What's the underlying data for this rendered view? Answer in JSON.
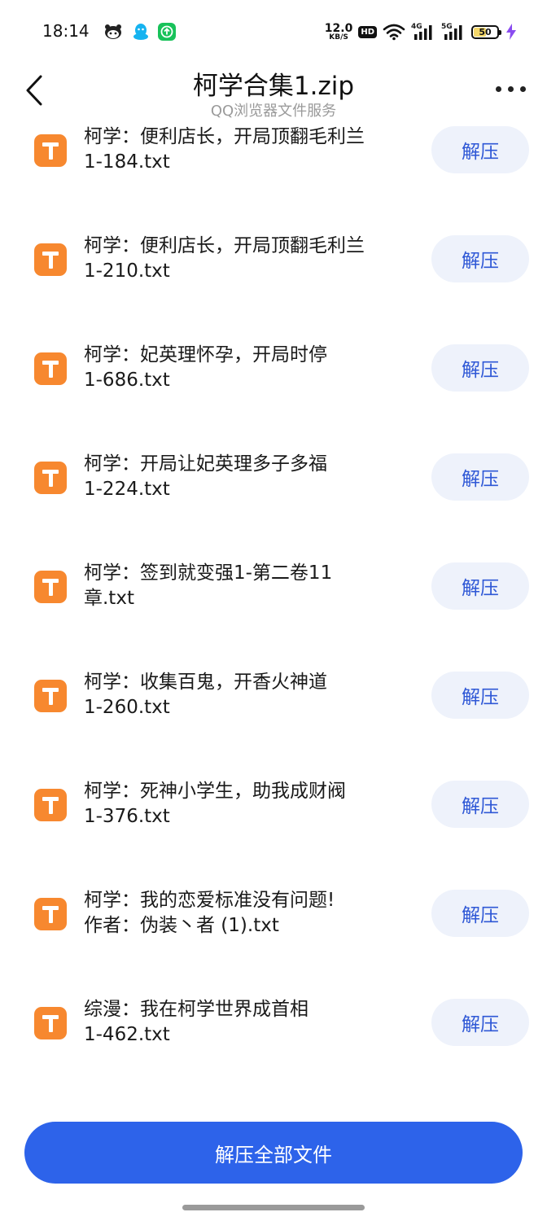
{
  "status_bar": {
    "time": "18:14",
    "net_speed_value": "12.0",
    "net_speed_unit": "KB/S",
    "hd_badge": "HD",
    "signal1_tag": "4G",
    "signal2_tag": "5G",
    "battery_level": 50,
    "battery_text": "50"
  },
  "header": {
    "title": "柯学合集1.zip",
    "subtitle": "QQ浏览器文件服务"
  },
  "files": [
    {
      "name_line1": "柯学：便利店长，开局顶翻毛利兰",
      "name_line2": "1-184.txt",
      "button": "解压"
    },
    {
      "name_line1": "柯学：便利店长，开局顶翻毛利兰",
      "name_line2": "1-210.txt",
      "button": "解压"
    },
    {
      "name_line1": "柯学：妃英理怀孕，开局时停",
      "name_line2": "1-686.txt",
      "button": "解压"
    },
    {
      "name_line1": "柯学：开局让妃英理多子多福",
      "name_line2": "1-224.txt",
      "button": "解压"
    },
    {
      "name_line1": "柯学：签到就变强1-第二卷11",
      "name_line2": "章.txt",
      "button": "解压"
    },
    {
      "name_line1": "柯学：收集百鬼，开香火神道",
      "name_line2": "1-260.txt",
      "button": "解压"
    },
    {
      "name_line1": "柯学：死神小学生，助我成财阀",
      "name_line2": "1-376.txt",
      "button": "解压"
    },
    {
      "name_line1": "柯学：我的恋爱标准没有问题!",
      "name_line2": "作者：伪装丶者 (1).txt",
      "button": "解压"
    },
    {
      "name_line1": "综漫：我在柯学世界成首相",
      "name_line2": "1-462.txt",
      "button": "解压"
    }
  ],
  "bottom": {
    "extract_all_label": "解压全部文件"
  },
  "colors": {
    "accent": "#2d63ea",
    "button_bg": "#eef2fb",
    "button_text": "#2f58d6",
    "file_icon": "#f7882f",
    "subtitle": "#9a9a9a"
  },
  "icons": {
    "back": "chevron-left-icon",
    "more": "more-dots-icon",
    "file": "text-file-icon",
    "wifi": "wifi-icon",
    "signal": "cell-signal-icon",
    "battery": "battery-icon",
    "charging": "charging-bolt-icon"
  }
}
